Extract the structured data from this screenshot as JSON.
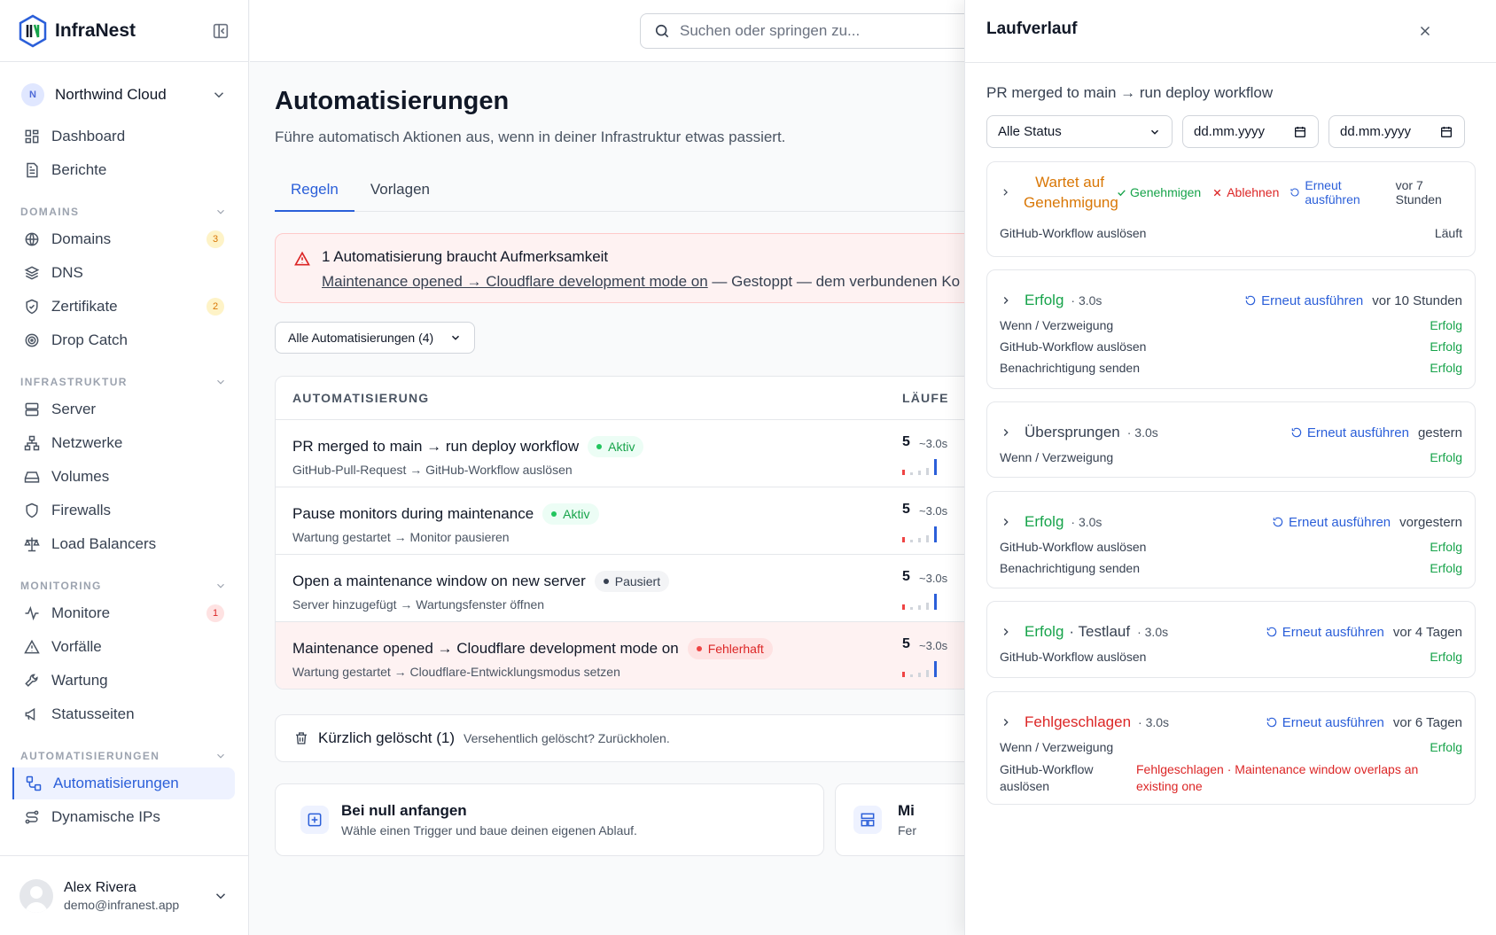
{
  "app": {
    "name": "InfraNest"
  },
  "org": {
    "initial": "N",
    "name": "Northwind Cloud"
  },
  "nav": {
    "top": [
      {
        "label": "Dashboard"
      },
      {
        "label": "Berichte"
      }
    ],
    "sections": [
      {
        "title": "DOMAINS",
        "items": [
          {
            "label": "Domains",
            "count": "3"
          },
          {
            "label": "DNS"
          },
          {
            "label": "Zertifikate",
            "count": "2"
          },
          {
            "label": "Drop Catch"
          }
        ]
      },
      {
        "title": "INFRASTRUKTUR",
        "items": [
          {
            "label": "Server"
          },
          {
            "label": "Netzwerke"
          },
          {
            "label": "Volumes"
          },
          {
            "label": "Firewalls"
          },
          {
            "label": "Load Balancers"
          }
        ]
      },
      {
        "title": "MONITORING",
        "items": [
          {
            "label": "Monitore",
            "count": "1"
          },
          {
            "label": "Vorfälle"
          },
          {
            "label": "Wartung"
          },
          {
            "label": "Statusseiten"
          }
        ]
      },
      {
        "title": "AUTOMATISIERUNGEN",
        "items": [
          {
            "label": "Automatisierungen",
            "active": true
          },
          {
            "label": "Dynamische IPs"
          }
        ]
      }
    ]
  },
  "user": {
    "name": "Alex Rivera",
    "email": "demo@infranest.app"
  },
  "search": {
    "placeholder": "Suchen oder springen zu..."
  },
  "page": {
    "title": "Automatisierungen",
    "subtitle": "Führe automatisch Aktionen aus, wenn in deiner Infrastruktur etwas passiert.",
    "tabs": [
      "Regeln",
      "Vorlagen"
    ]
  },
  "alert": {
    "title": "1 Automatisierung braucht Aufmerksamkeit",
    "link": "Maintenance opened → Cloudflare development mode on",
    "text": " — Gestoppt — dem verbundenen Ko"
  },
  "filter": {
    "label": "Alle Automatisierungen (4)"
  },
  "table": {
    "headers": [
      "AUTOMATISIERUNG",
      "LÄUFE"
    ],
    "rows": [
      {
        "title": "PR merged to main → run deploy workflow",
        "status": "Aktiv",
        "sub": "GitHub-Pull-Request → GitHub-Workflow auslösen",
        "runs": "5",
        "duration": "~3.0s"
      },
      {
        "title": "Pause monitors during maintenance",
        "status": "Aktiv",
        "sub": "Wartung gestartet → Monitor pausieren",
        "runs": "5",
        "duration": "~3.0s"
      },
      {
        "title": "Open a maintenance window on new server",
        "status": "Pausiert",
        "sub": "Server hinzugefügt → Wartungsfenster öffnen",
        "runs": "5",
        "duration": "~3.0s"
      },
      {
        "title": "Maintenance opened → Cloudflare development mode on",
        "status": "Fehlerhaft",
        "sub": "Wartung gestartet → Cloudflare-Entwicklungsmodus setzen",
        "runs": "5",
        "duration": "~3.0s"
      }
    ]
  },
  "deleted": {
    "title": "Kürzlich gelöscht (1)",
    "hint": "Versehentlich gelöscht? Zurückholen."
  },
  "cards": [
    {
      "title": "Bei null anfangen",
      "sub": "Wähle einen Trigger und baue deinen eigenen Ablauf."
    },
    {
      "title": "Mi",
      "sub": "Fer"
    }
  ],
  "panel": {
    "title": "Laufverlauf",
    "subtitle": "PR merged to main → run deploy workflow",
    "status_filter": "Alle Status",
    "date_placeholder": "dd.mm.yyyy",
    "runs": [
      {
        "status": "Wartet auf Genehmigung",
        "approve": "Genehmigen",
        "reject": "Ablehnen",
        "rerun": "Erneut ausführen",
        "when": "vor 7 Stunden",
        "steps": [
          {
            "name": "GitHub-Workflow auslösen",
            "result": "Läuft"
          }
        ]
      },
      {
        "status": "Erfolg",
        "duration": "· 3.0s",
        "rerun": "Erneut ausführen",
        "when": "vor 10 Stunden",
        "steps": [
          {
            "name": "Wenn / Verzweigung",
            "result": "Erfolg"
          },
          {
            "name": "GitHub-Workflow auslösen",
            "result": "Erfolg"
          },
          {
            "name": "Benachrichtigung senden",
            "result": "Erfolg"
          }
        ]
      },
      {
        "status": "Übersprungen",
        "duration": "· 3.0s",
        "rerun": "Erneut ausführen",
        "when": "gestern",
        "steps": [
          {
            "name": "Wenn / Verzweigung",
            "result": "Erfolg"
          }
        ]
      },
      {
        "status": "Erfolg",
        "duration": "· 3.0s",
        "rerun": "Erneut ausführen",
        "when": "vorgestern",
        "steps": [
          {
            "name": "GitHub-Workflow auslösen",
            "result": "Erfolg"
          },
          {
            "name": "Benachrichtigung senden",
            "result": "Erfolg"
          }
        ]
      },
      {
        "status": "Erfolg",
        "status_suffix": "· Testlauf",
        "duration": "· 3.0s",
        "rerun": "Erneut ausführen",
        "when": "vor 4 Tagen",
        "steps": [
          {
            "name": "GitHub-Workflow auslösen",
            "result": "Erfolg"
          }
        ]
      },
      {
        "status": "Fehlgeschlagen",
        "duration": "· 3.0s",
        "rerun": "Erneut ausführen",
        "when": "vor 6 Tagen",
        "steps": [
          {
            "name": "Wenn / Verzweigung",
            "result": "Erfolg"
          },
          {
            "name": "GitHub-Workflow auslösen",
            "result": "Fehlgeschlagen · Maintenance window overlaps an existing one"
          }
        ]
      }
    ]
  }
}
